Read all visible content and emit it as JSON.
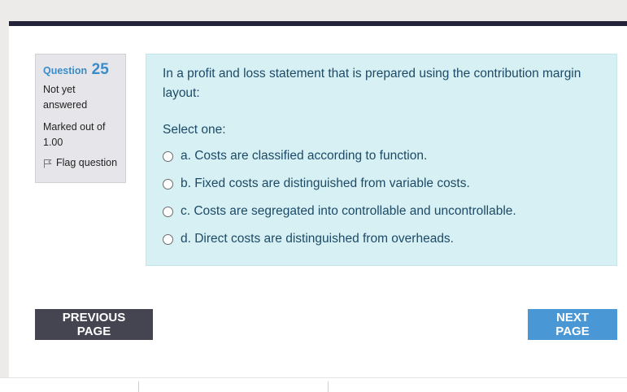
{
  "question": {
    "label": "Question",
    "number": "25",
    "state": "Not yet answered",
    "marked_out_of": "Marked out of 1.00",
    "flag_label": "Flag question"
  },
  "prompt": {
    "text": "In a profit and loss statement that is prepared using the contribution margin layout:",
    "select_label": "Select one:"
  },
  "options": [
    {
      "label": "a. Costs are classified according to function.",
      "selected": false
    },
    {
      "label": "b. Fixed costs are distinguished from variable costs.",
      "selected": false
    },
    {
      "label": "c. Costs are segregated into controllable and uncontrollable.",
      "selected": false
    },
    {
      "label": "d. Direct costs are distinguished from overheads.",
      "selected": false
    }
  ],
  "navigation": {
    "previous_label": "PREVIOUS PAGE",
    "next_label": "NEXT PAGE"
  },
  "colors": {
    "question_number": "#3a8cc8",
    "question_panel": "#d6f0f4",
    "previous_button": "#444551",
    "next_button": "#4a97d6",
    "header_bar": "#24233a"
  }
}
